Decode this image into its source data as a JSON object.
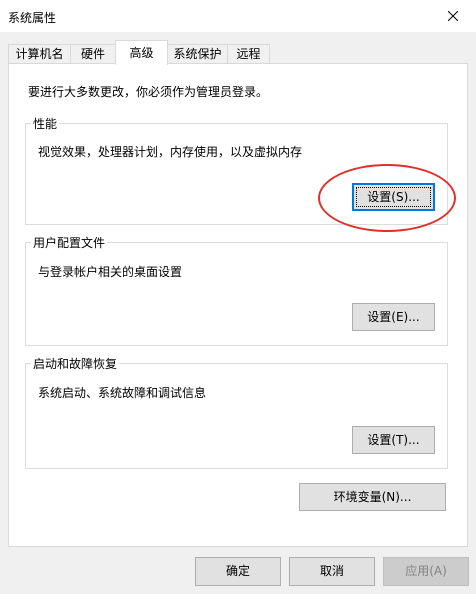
{
  "window": {
    "title": "系统属性",
    "close_icon": "close-icon"
  },
  "tabs": [
    {
      "label": "计算机名",
      "active": false
    },
    {
      "label": "硬件",
      "active": false
    },
    {
      "label": "高级",
      "active": true
    },
    {
      "label": "系统保护",
      "active": false
    },
    {
      "label": "远程",
      "active": false
    }
  ],
  "notice": "要进行大多数更改，你必须作为管理员登录。",
  "performance": {
    "title": "性能",
    "description": "视觉效果，处理器计划，内存使用，以及虚拟内存",
    "button_label": "设置(S)..."
  },
  "user_profiles": {
    "title": "用户配置文件",
    "description": "与登录帐户相关的桌面设置",
    "button_label": "设置(E)..."
  },
  "startup_recovery": {
    "title": "启动和故障恢复",
    "description": "系统启动、系统故障和调试信息",
    "button_label": "设置(T)..."
  },
  "env_vars_label": "环境变量(N)...",
  "footer": {
    "ok_label": "确定",
    "cancel_label": "取消",
    "apply_label": "应用(A)"
  },
  "colors": {
    "annotation": "#e0302c",
    "focus": "#0078d7"
  }
}
